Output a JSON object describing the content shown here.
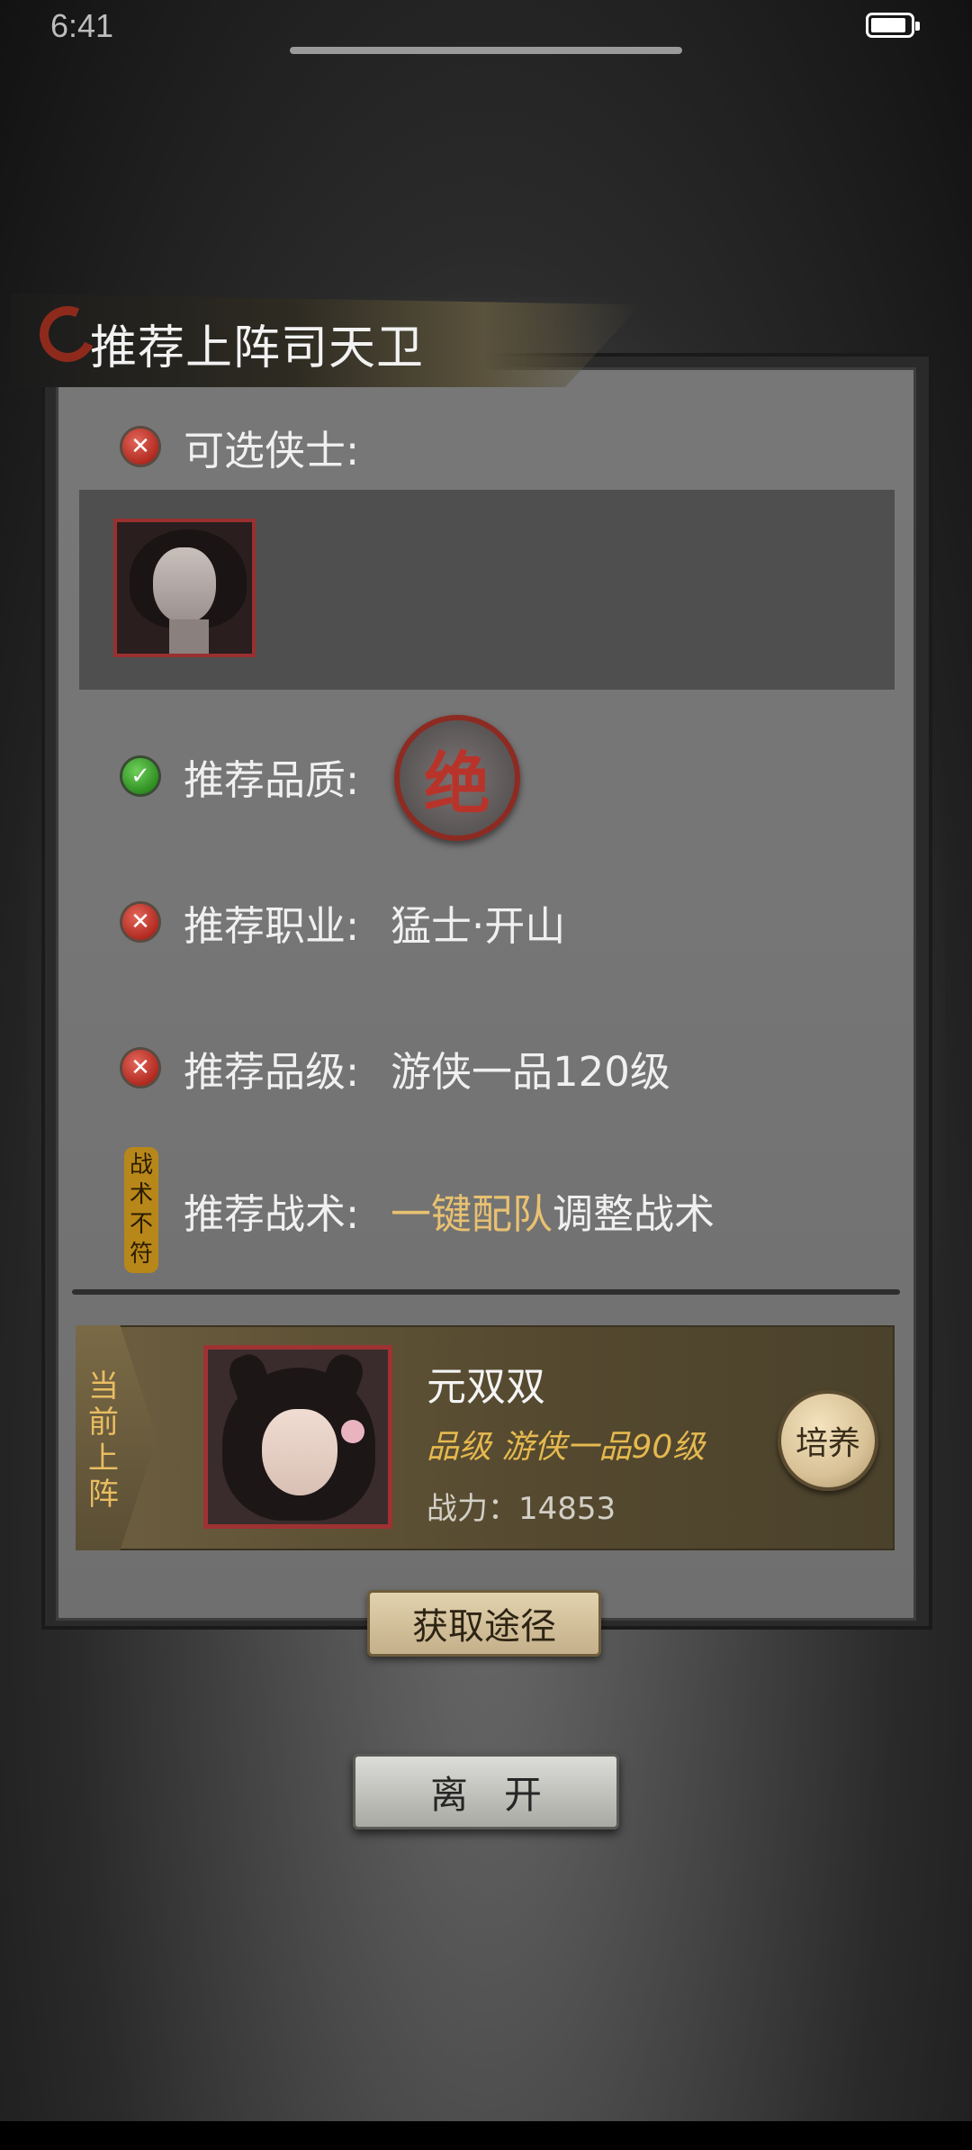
{
  "status_bar": {
    "time": "6:41",
    "battery_level": 0.9
  },
  "dialog": {
    "title": "推荐上阵司天卫",
    "rows": {
      "selectable": {
        "label": "可选侠士:",
        "status": "fail"
      },
      "quality": {
        "label": "推荐品质:",
        "seal_text": "绝",
        "status": "pass"
      },
      "profession": {
        "label": "推荐职业:",
        "value": "猛士·开山",
        "status": "fail"
      },
      "grade": {
        "label": "推荐品级:",
        "value": "游侠一品120级",
        "status": "fail"
      },
      "tactics": {
        "label": "推荐战术:",
        "tag_chars": [
          "战",
          "术",
          "不",
          "符"
        ],
        "highlight": "一键配队",
        "suffix": "调整战术"
      }
    },
    "current": {
      "tag_chars": [
        "当",
        "前",
        "上",
        "阵"
      ],
      "name": "元双双",
      "grade": "品级 游侠一品90级",
      "power": "战力：14853",
      "train_label": "培养"
    },
    "obtain_label": "获取途径"
  },
  "leave_label": "离开"
}
